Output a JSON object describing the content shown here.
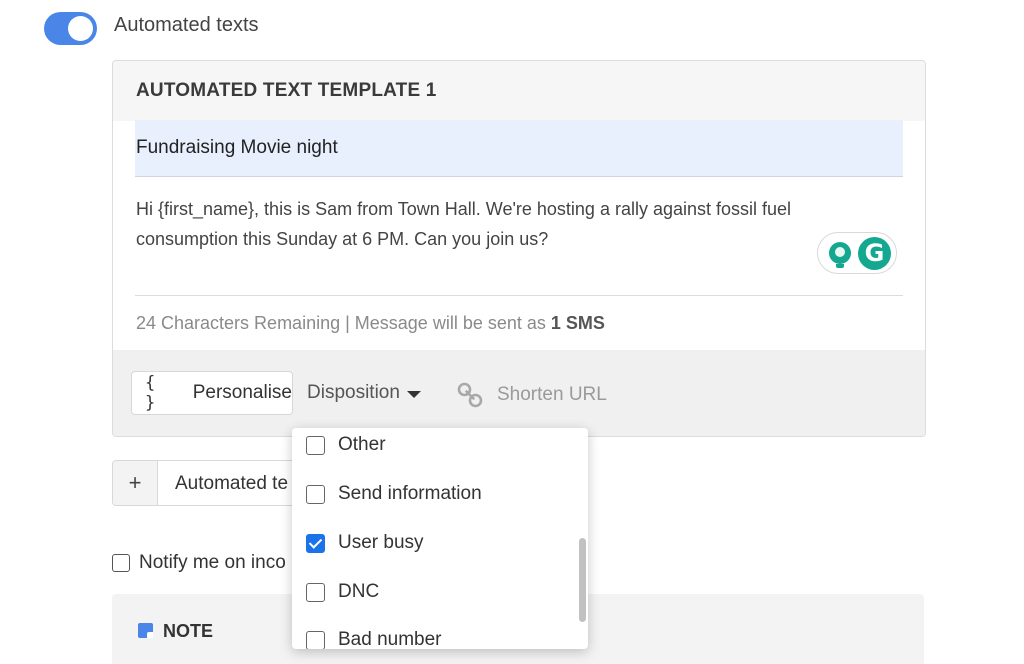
{
  "automation": {
    "toggle_label": "Automated texts",
    "toggle_on": true
  },
  "template": {
    "title": "AUTOMATED TEXT TEMPLATE 1",
    "subject": "Fundraising Movie night",
    "message": "Hi {first_name}, this is Sam from Town Hall. We're hosting a rally against fossil fuel consumption this Sunday at 6 PM. Can you join us?",
    "chars_remaining_text": "24 Characters Remaining | Message will be sent as ",
    "sms_count_text": "1 SMS"
  },
  "grammarly": {
    "letter": "G",
    "color": "#15a890"
  },
  "toolbar": {
    "personalise_icon": "{ }",
    "personalise_label": "Personalise",
    "disposition_label": "Disposition",
    "shorten_url_label": "Shorten URL"
  },
  "add_template": {
    "plus": "+",
    "label": "Automated te"
  },
  "notify": {
    "label": "Notify me on inco"
  },
  "note": {
    "title": "NOTE"
  },
  "disposition_menu": {
    "items": [
      {
        "label": "Other",
        "checked": false
      },
      {
        "label": "Send information",
        "checked": false
      },
      {
        "label": "User busy",
        "checked": true
      },
      {
        "label": "DNC",
        "checked": false
      },
      {
        "label": "Bad number",
        "checked": false
      }
    ]
  },
  "colors": {
    "accent": "#4a86e8",
    "checkbox_checked": "#1a73e8",
    "subject_bg": "#e8f0fe"
  }
}
